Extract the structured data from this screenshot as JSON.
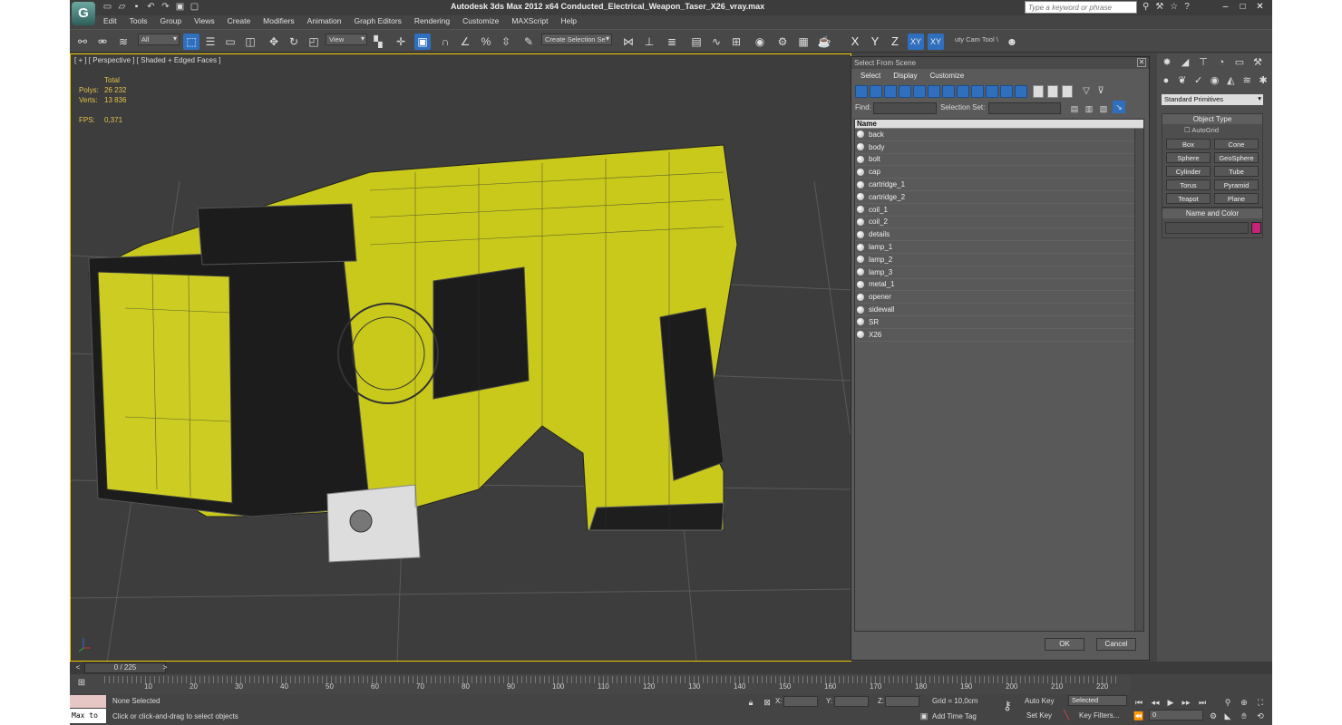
{
  "window": {
    "title": "Autodesk 3ds Max  2012 x64      Conducted_Electrical_Weapon_Taser_X26_vray.max",
    "search_placeholder": "Type a keyword or phrase"
  },
  "menu": [
    "Edit",
    "Tools",
    "Group",
    "Views",
    "Create",
    "Modifiers",
    "Animation",
    "Graph Editors",
    "Rendering",
    "Customize",
    "MAXScript",
    "Help"
  ],
  "toolbar": {
    "filter_value": "All",
    "refcoord_value": "View",
    "selection_set": "Create Selection Se",
    "axes": [
      "X",
      "Y",
      "Z",
      "XY",
      "XY"
    ],
    "cam_tool": "uty Cam Tool \\"
  },
  "viewport": {
    "label": "[ + ] [ Perspective ] [ Shaded + Edged Faces ]",
    "stats_total": "Total",
    "polys_label": "Polys:",
    "polys_value": "26 232",
    "verts_label": "Verts:",
    "verts_value": "13 836",
    "fps_label": "FPS:",
    "fps_value": "0,371"
  },
  "select_dialog": {
    "title": "Select From Scene",
    "menu": [
      "Select",
      "Display",
      "Customize"
    ],
    "find_label": "Find:",
    "selection_set_label": "Selection Set:",
    "column_name": "Name",
    "objects": [
      "back",
      "body",
      "bolt",
      "cap",
      "cartridge_1",
      "cartridge_2",
      "coil_1",
      "coil_2",
      "details",
      "lamp_1",
      "lamp_2",
      "lamp_3",
      "metal_1",
      "opener",
      "sidewall",
      "SR",
      "X26"
    ],
    "ok": "OK",
    "cancel": "Cancel"
  },
  "command_panel": {
    "category": "Standard Primitives",
    "object_type_header": "Object Type",
    "autogrid": "AutoGrid",
    "primitives": [
      "Box",
      "Cone",
      "Sphere",
      "GeoSphere",
      "Cylinder",
      "Tube",
      "Torus",
      "Pyramid",
      "Teapot",
      "Plane"
    ],
    "name_color_header": "Name and Color",
    "object_color": "#c8237a"
  },
  "timeline": {
    "frame": "0 / 225",
    "ticks": [
      "10",
      "20",
      "30",
      "40",
      "50",
      "60",
      "70",
      "80",
      "90",
      "100",
      "110",
      "120",
      "130",
      "140",
      "150",
      "160",
      "170",
      "180",
      "190",
      "200",
      "210",
      "220"
    ]
  },
  "status": {
    "maxscript": "Max to",
    "selection": "None Selected",
    "prompt": "Click or click-and-drag to select objects",
    "x_label": "X:",
    "y_label": "Y:",
    "z_label": "Z:",
    "grid": "Grid = 10,0cm",
    "add_time_tag": "Add Time Tag",
    "auto_key": "Auto Key",
    "set_key": "Set Key",
    "key_mode": "Selected",
    "key_filters": "Key Filters...",
    "frame_field": "0"
  }
}
